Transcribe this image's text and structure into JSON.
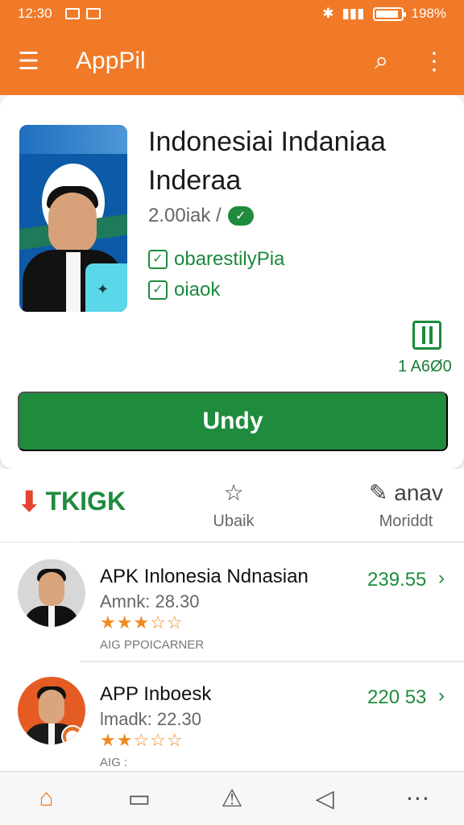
{
  "status": {
    "time": "12:30",
    "battery": "198%",
    "battery_fill": 0.9
  },
  "app_bar": {
    "title": "AppPil"
  },
  "app_card": {
    "title": "Indonesiai Indaniaa Inderaa",
    "meta": "2.00iak /",
    "features": [
      "obarestilyPia",
      "oiaok"
    ],
    "size_value": "1 A6Ø0",
    "install_label": "Undy"
  },
  "stats": {
    "brand": "TKIGK",
    "items": [
      {
        "label": "Ubaik"
      },
      {
        "label": "Moriddt"
      }
    ],
    "anav_label": "anav"
  },
  "list": [
    {
      "name": "APK Inlonesia Ndnasian",
      "sub": "Amnk: 28.30",
      "stars": "★★★☆☆",
      "small": "AIG PPOICARNER",
      "price": "239.55"
    },
    {
      "name": "APP Inboesk",
      "sub": "lmadk: 22.30",
      "stars": "★★☆☆☆",
      "small": "AIG :",
      "price": "220 53"
    }
  ],
  "bottom_nav": [
    "home-icon",
    "square-icon",
    "alert-icon",
    "back-icon",
    "more-icon"
  ],
  "colors": {
    "primary": "#f07a27",
    "accent": "#1f8b3d",
    "star": "#f08a24"
  }
}
